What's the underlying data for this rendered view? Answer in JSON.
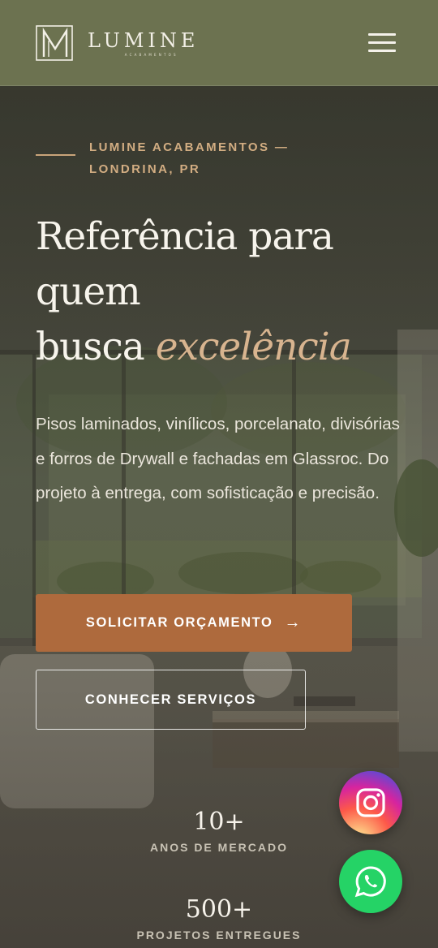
{
  "header": {
    "brand_name": "LUMINE",
    "brand_sub": "ACABAMENTOS",
    "menu_icon": "hamburger-menu-icon"
  },
  "hero": {
    "eyebrow": "LUMINE ACABAMENTOS — LONDRINA, PR",
    "headline_line1": "Referência para",
    "headline_line2": "quem",
    "headline_line3": "busca ",
    "headline_highlight": "excelência",
    "description": "Pisos laminados, vinílicos, porcelanato, divisórias e forros de Drywall e fachadas em Glassroc. Do projeto à entrega, com sofisticação e precisão.",
    "primary_cta": "SOLICITAR ORÇAMENTO",
    "primary_cta_icon": "→",
    "secondary_cta": "CONHECER SERVIÇOS"
  },
  "stats": [
    {
      "value": "10+",
      "label": "ANOS DE MERCADO"
    },
    {
      "value": "500+",
      "label": "PROJETOS ENTREGUES"
    }
  ],
  "floating": {
    "instagram_icon": "instagram-icon",
    "whatsapp_icon": "whatsapp-icon"
  },
  "colors": {
    "header_bg": "#6c7250",
    "accent_gold": "#d2ad82",
    "cta_bg": "#ae6a3d",
    "whatsapp_green": "#25d366"
  }
}
